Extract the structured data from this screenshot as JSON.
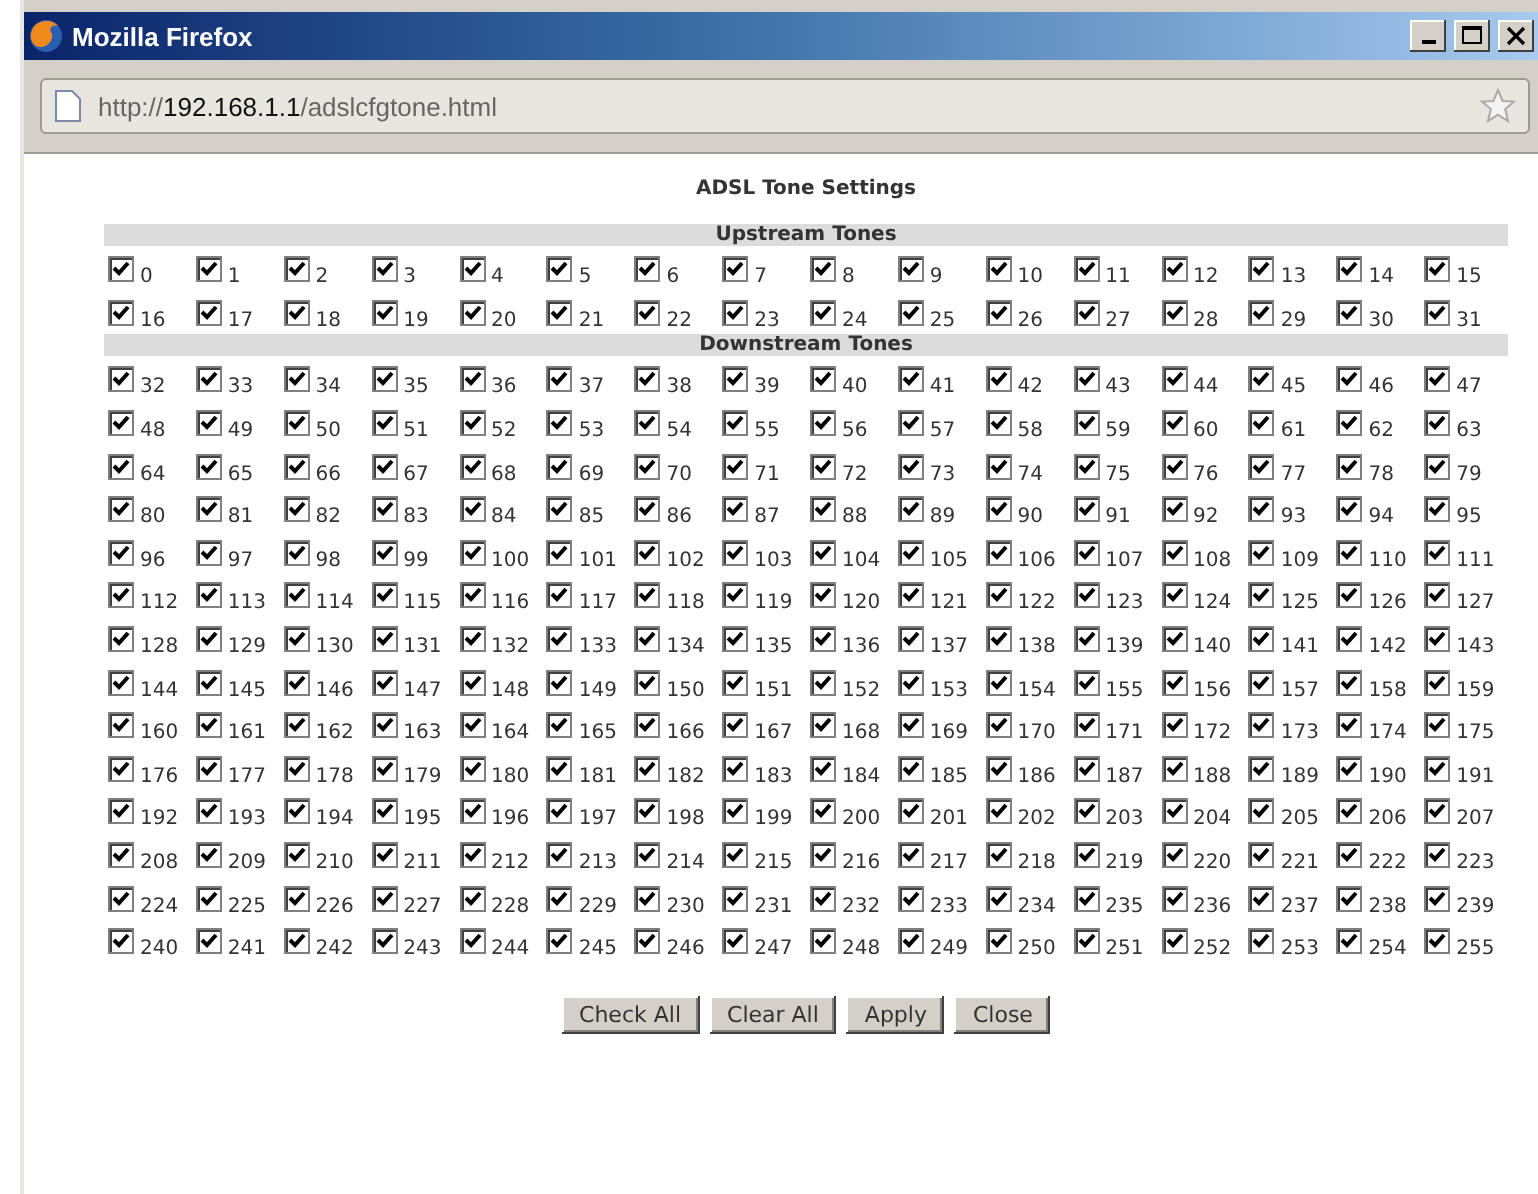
{
  "window": {
    "title": "Mozilla Firefox"
  },
  "address_bar": {
    "scheme": "http://",
    "host": "192.168.1.1",
    "path": "/adslcfgtone.html"
  },
  "page": {
    "heading": "ADSL Tone Settings",
    "sections": [
      {
        "title": "Upstream Tones",
        "tones": [
          {
            "label": "0",
            "checked": true
          },
          {
            "label": "1",
            "checked": true
          },
          {
            "label": "2",
            "checked": true
          },
          {
            "label": "3",
            "checked": true
          },
          {
            "label": "4",
            "checked": true
          },
          {
            "label": "5",
            "checked": true
          },
          {
            "label": "6",
            "checked": true
          },
          {
            "label": "7",
            "checked": true
          },
          {
            "label": "8",
            "checked": true
          },
          {
            "label": "9",
            "checked": true
          },
          {
            "label": "10",
            "checked": true
          },
          {
            "label": "11",
            "checked": true
          },
          {
            "label": "12",
            "checked": true
          },
          {
            "label": "13",
            "checked": true
          },
          {
            "label": "14",
            "checked": true
          },
          {
            "label": "15",
            "checked": true
          },
          {
            "label": "16",
            "checked": true
          },
          {
            "label": "17",
            "checked": true
          },
          {
            "label": "18",
            "checked": true
          },
          {
            "label": "19",
            "checked": true
          },
          {
            "label": "20",
            "checked": true
          },
          {
            "label": "21",
            "checked": true
          },
          {
            "label": "22",
            "checked": true
          },
          {
            "label": "23",
            "checked": true
          },
          {
            "label": "24",
            "checked": true
          },
          {
            "label": "25",
            "checked": true
          },
          {
            "label": "26",
            "checked": true
          },
          {
            "label": "27",
            "checked": true
          },
          {
            "label": "28",
            "checked": true
          },
          {
            "label": "29",
            "checked": true
          },
          {
            "label": "30",
            "checked": true
          },
          {
            "label": "31",
            "checked": true
          }
        ]
      },
      {
        "title": "Downstream Tones",
        "tones": [
          {
            "label": "32",
            "checked": true
          },
          {
            "label": "33",
            "checked": true
          },
          {
            "label": "34",
            "checked": true
          },
          {
            "label": "35",
            "checked": true
          },
          {
            "label": "36",
            "checked": true
          },
          {
            "label": "37",
            "checked": true
          },
          {
            "label": "38",
            "checked": true
          },
          {
            "label": "39",
            "checked": true
          },
          {
            "label": "40",
            "checked": true
          },
          {
            "label": "41",
            "checked": true
          },
          {
            "label": "42",
            "checked": true
          },
          {
            "label": "43",
            "checked": true
          },
          {
            "label": "44",
            "checked": true
          },
          {
            "label": "45",
            "checked": true
          },
          {
            "label": "46",
            "checked": true
          },
          {
            "label": "47",
            "checked": true
          },
          {
            "label": "48",
            "checked": true
          },
          {
            "label": "49",
            "checked": true
          },
          {
            "label": "50",
            "checked": true
          },
          {
            "label": "51",
            "checked": true
          },
          {
            "label": "52",
            "checked": true
          },
          {
            "label": "53",
            "checked": true
          },
          {
            "label": "54",
            "checked": true
          },
          {
            "label": "55",
            "checked": true
          },
          {
            "label": "56",
            "checked": true
          },
          {
            "label": "57",
            "checked": true
          },
          {
            "label": "58",
            "checked": true
          },
          {
            "label": "59",
            "checked": true
          },
          {
            "label": "60",
            "checked": true
          },
          {
            "label": "61",
            "checked": true
          },
          {
            "label": "62",
            "checked": true
          },
          {
            "label": "63",
            "checked": true
          },
          {
            "label": "64",
            "checked": true
          },
          {
            "label": "65",
            "checked": true
          },
          {
            "label": "66",
            "checked": true
          },
          {
            "label": "67",
            "checked": true
          },
          {
            "label": "68",
            "checked": true
          },
          {
            "label": "69",
            "checked": true
          },
          {
            "label": "70",
            "checked": true
          },
          {
            "label": "71",
            "checked": true
          },
          {
            "label": "72",
            "checked": true
          },
          {
            "label": "73",
            "checked": true
          },
          {
            "label": "74",
            "checked": true
          },
          {
            "label": "75",
            "checked": true
          },
          {
            "label": "76",
            "checked": true
          },
          {
            "label": "77",
            "checked": true
          },
          {
            "label": "78",
            "checked": true
          },
          {
            "label": "79",
            "checked": true
          },
          {
            "label": "80",
            "checked": true
          },
          {
            "label": "81",
            "checked": true
          },
          {
            "label": "82",
            "checked": true
          },
          {
            "label": "83",
            "checked": true
          },
          {
            "label": "84",
            "checked": true
          },
          {
            "label": "85",
            "checked": true
          },
          {
            "label": "86",
            "checked": true
          },
          {
            "label": "87",
            "checked": true
          },
          {
            "label": "88",
            "checked": true
          },
          {
            "label": "89",
            "checked": true
          },
          {
            "label": "90",
            "checked": true
          },
          {
            "label": "91",
            "checked": true
          },
          {
            "label": "92",
            "checked": true
          },
          {
            "label": "93",
            "checked": true
          },
          {
            "label": "94",
            "checked": true
          },
          {
            "label": "95",
            "checked": true
          },
          {
            "label": "96",
            "checked": true
          },
          {
            "label": "97",
            "checked": true
          },
          {
            "label": "98",
            "checked": true
          },
          {
            "label": "99",
            "checked": true
          },
          {
            "label": "100",
            "checked": true
          },
          {
            "label": "101",
            "checked": true
          },
          {
            "label": "102",
            "checked": true
          },
          {
            "label": "103",
            "checked": true
          },
          {
            "label": "104",
            "checked": true
          },
          {
            "label": "105",
            "checked": true
          },
          {
            "label": "106",
            "checked": true
          },
          {
            "label": "107",
            "checked": true
          },
          {
            "label": "108",
            "checked": true
          },
          {
            "label": "109",
            "checked": true
          },
          {
            "label": "110",
            "checked": true
          },
          {
            "label": "111",
            "checked": true
          },
          {
            "label": "112",
            "checked": true
          },
          {
            "label": "113",
            "checked": true
          },
          {
            "label": "114",
            "checked": true
          },
          {
            "label": "115",
            "checked": true
          },
          {
            "label": "116",
            "checked": true
          },
          {
            "label": "117",
            "checked": true
          },
          {
            "label": "118",
            "checked": true
          },
          {
            "label": "119",
            "checked": true
          },
          {
            "label": "120",
            "checked": true
          },
          {
            "label": "121",
            "checked": true
          },
          {
            "label": "122",
            "checked": true
          },
          {
            "label": "123",
            "checked": true
          },
          {
            "label": "124",
            "checked": true
          },
          {
            "label": "125",
            "checked": true
          },
          {
            "label": "126",
            "checked": true
          },
          {
            "label": "127",
            "checked": true
          },
          {
            "label": "128",
            "checked": true
          },
          {
            "label": "129",
            "checked": true
          },
          {
            "label": "130",
            "checked": true
          },
          {
            "label": "131",
            "checked": true
          },
          {
            "label": "132",
            "checked": true
          },
          {
            "label": "133",
            "checked": true
          },
          {
            "label": "134",
            "checked": true
          },
          {
            "label": "135",
            "checked": true
          },
          {
            "label": "136",
            "checked": true
          },
          {
            "label": "137",
            "checked": true
          },
          {
            "label": "138",
            "checked": true
          },
          {
            "label": "139",
            "checked": true
          },
          {
            "label": "140",
            "checked": true
          },
          {
            "label": "141",
            "checked": true
          },
          {
            "label": "142",
            "checked": true
          },
          {
            "label": "143",
            "checked": true
          },
          {
            "label": "144",
            "checked": true
          },
          {
            "label": "145",
            "checked": true
          },
          {
            "label": "146",
            "checked": true
          },
          {
            "label": "147",
            "checked": true
          },
          {
            "label": "148",
            "checked": true
          },
          {
            "label": "149",
            "checked": true
          },
          {
            "label": "150",
            "checked": true
          },
          {
            "label": "151",
            "checked": true
          },
          {
            "label": "152",
            "checked": true
          },
          {
            "label": "153",
            "checked": true
          },
          {
            "label": "154",
            "checked": true
          },
          {
            "label": "155",
            "checked": true
          },
          {
            "label": "156",
            "checked": true
          },
          {
            "label": "157",
            "checked": true
          },
          {
            "label": "158",
            "checked": true
          },
          {
            "label": "159",
            "checked": true
          },
          {
            "label": "160",
            "checked": true
          },
          {
            "label": "161",
            "checked": true
          },
          {
            "label": "162",
            "checked": true
          },
          {
            "label": "163",
            "checked": true
          },
          {
            "label": "164",
            "checked": true
          },
          {
            "label": "165",
            "checked": true
          },
          {
            "label": "166",
            "checked": true
          },
          {
            "label": "167",
            "checked": true
          },
          {
            "label": "168",
            "checked": true
          },
          {
            "label": "169",
            "checked": true
          },
          {
            "label": "170",
            "checked": true
          },
          {
            "label": "171",
            "checked": true
          },
          {
            "label": "172",
            "checked": true
          },
          {
            "label": "173",
            "checked": true
          },
          {
            "label": "174",
            "checked": true
          },
          {
            "label": "175",
            "checked": true
          },
          {
            "label": "176",
            "checked": true
          },
          {
            "label": "177",
            "checked": true
          },
          {
            "label": "178",
            "checked": true
          },
          {
            "label": "179",
            "checked": true
          },
          {
            "label": "180",
            "checked": true
          },
          {
            "label": "181",
            "checked": true
          },
          {
            "label": "182",
            "checked": true
          },
          {
            "label": "183",
            "checked": true
          },
          {
            "label": "184",
            "checked": true
          },
          {
            "label": "185",
            "checked": true
          },
          {
            "label": "186",
            "checked": true
          },
          {
            "label": "187",
            "checked": true
          },
          {
            "label": "188",
            "checked": true
          },
          {
            "label": "189",
            "checked": true
          },
          {
            "label": "190",
            "checked": true
          },
          {
            "label": "191",
            "checked": true
          },
          {
            "label": "192",
            "checked": true
          },
          {
            "label": "193",
            "checked": true
          },
          {
            "label": "194",
            "checked": true
          },
          {
            "label": "195",
            "checked": true
          },
          {
            "label": "196",
            "checked": true
          },
          {
            "label": "197",
            "checked": true
          },
          {
            "label": "198",
            "checked": true
          },
          {
            "label": "199",
            "checked": true
          },
          {
            "label": "200",
            "checked": true
          },
          {
            "label": "201",
            "checked": true
          },
          {
            "label": "202",
            "checked": true
          },
          {
            "label": "203",
            "checked": true
          },
          {
            "label": "204",
            "checked": true
          },
          {
            "label": "205",
            "checked": true
          },
          {
            "label": "206",
            "checked": true
          },
          {
            "label": "207",
            "checked": true
          },
          {
            "label": "208",
            "checked": true
          },
          {
            "label": "209",
            "checked": true
          },
          {
            "label": "210",
            "checked": true
          },
          {
            "label": "211",
            "checked": true
          },
          {
            "label": "212",
            "checked": true
          },
          {
            "label": "213",
            "checked": true
          },
          {
            "label": "214",
            "checked": true
          },
          {
            "label": "215",
            "checked": true
          },
          {
            "label": "216",
            "checked": true
          },
          {
            "label": "217",
            "checked": true
          },
          {
            "label": "218",
            "checked": true
          },
          {
            "label": "219",
            "checked": true
          },
          {
            "label": "220",
            "checked": true
          },
          {
            "label": "221",
            "checked": true
          },
          {
            "label": "222",
            "checked": true
          },
          {
            "label": "223",
            "checked": true
          },
          {
            "label": "224",
            "checked": true
          },
          {
            "label": "225",
            "checked": true
          },
          {
            "label": "226",
            "checked": true
          },
          {
            "label": "227",
            "checked": true
          },
          {
            "label": "228",
            "checked": true
          },
          {
            "label": "229",
            "checked": true
          },
          {
            "label": "230",
            "checked": true
          },
          {
            "label": "231",
            "checked": true
          },
          {
            "label": "232",
            "checked": true
          },
          {
            "label": "233",
            "checked": true
          },
          {
            "label": "234",
            "checked": true
          },
          {
            "label": "235",
            "checked": true
          },
          {
            "label": "236",
            "checked": true
          },
          {
            "label": "237",
            "checked": true
          },
          {
            "label": "238",
            "checked": true
          },
          {
            "label": "239",
            "checked": true
          },
          {
            "label": "240",
            "checked": true
          },
          {
            "label": "241",
            "checked": true
          },
          {
            "label": "242",
            "checked": true
          },
          {
            "label": "243",
            "checked": true
          },
          {
            "label": "244",
            "checked": true
          },
          {
            "label": "245",
            "checked": true
          },
          {
            "label": "246",
            "checked": true
          },
          {
            "label": "247",
            "checked": true
          },
          {
            "label": "248",
            "checked": true
          },
          {
            "label": "249",
            "checked": true
          },
          {
            "label": "250",
            "checked": true
          },
          {
            "label": "251",
            "checked": true
          },
          {
            "label": "252",
            "checked": true
          },
          {
            "label": "253",
            "checked": true
          },
          {
            "label": "254",
            "checked": true
          },
          {
            "label": "255",
            "checked": true
          }
        ]
      }
    ],
    "buttons": [
      "Check All",
      "Clear All",
      "Apply",
      "Close"
    ]
  }
}
